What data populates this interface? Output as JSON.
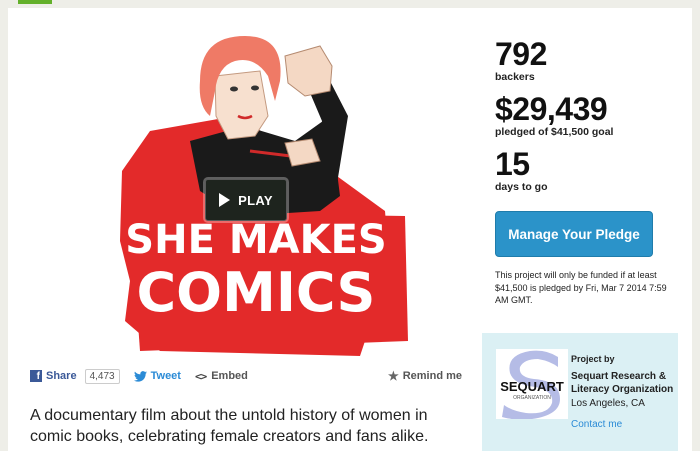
{
  "video": {
    "play_label": "PLAY",
    "poster_line1": "SHE MAKES",
    "poster_line2": "COMICS"
  },
  "share": {
    "facebook_label": "Share",
    "facebook_count": "4,473",
    "tweet_label": "Tweet",
    "embed_label": "Embed",
    "remind_label": "Remind me"
  },
  "blurb": "A documentary film about the untold history of women in comic books, celebrating female creators and fans alike.",
  "stats": {
    "backers_value": "792",
    "backers_label": "backers",
    "pledged_value": "$29,439",
    "pledged_label": "pledged of $41,500 goal",
    "days_value": "15",
    "days_label": "days to go"
  },
  "pledge_button_label": "Manage Your Pledge",
  "funding_note": "This project will only be funded if at least $41,500 is pledged by Fri, Mar 7 2014 7:59 AM GMT.",
  "creator": {
    "heading": "Project by",
    "name": "Sequart Research & Literacy Organization",
    "location": "Los Angeles, CA",
    "contact_label": "Contact me",
    "logo_text": "SEQUART",
    "logo_subtext": "ORGANIZATION"
  },
  "colors": {
    "accent_green": "#63b02a",
    "pledge_blue": "#2b93c9",
    "poster_red": "#e32a2a",
    "creator_bg": "#dbf0f4"
  }
}
